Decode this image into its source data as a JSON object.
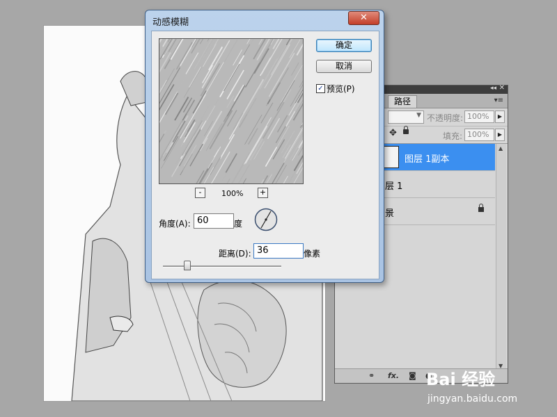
{
  "dialog": {
    "title": "动感模糊",
    "close_symbol": "✕",
    "ok_label": "确定",
    "cancel_label": "取消",
    "preview_label": "预览(P)",
    "preview_checked": true,
    "zoom_minus": "-",
    "zoom_level": "100%",
    "zoom_plus": "+",
    "angle_label": "角度(A):",
    "angle_value": "60",
    "angle_unit": "度",
    "distance_label": "距离(D):",
    "distance_value": "36",
    "distance_unit": "像素",
    "slider_fraction": 0.2
  },
  "layers_panel": {
    "tab_label": "路径",
    "opacity_label": "不透明度:",
    "opacity_value": "100%",
    "fill_label": "填充:",
    "fill_value": "100%",
    "layers": [
      {
        "name": "图层 1副本",
        "selected": true
      },
      {
        "name": "层 1",
        "selected": false
      },
      {
        "name": "景",
        "selected": false
      }
    ],
    "footer_fx": "fx."
  },
  "watermark": {
    "logo": "Bai 经验",
    "url": "jingyan.baidu.com"
  },
  "colors": {
    "selection": "#3b8ff0",
    "dialog_frame": "#a9c3e3",
    "close_button": "#c4402a"
  },
  "icons": [
    "close-icon",
    "checkbox-icon",
    "angle-dial-icon",
    "move-icon",
    "lock-icon",
    "link-icon",
    "fx-icon",
    "mask-icon",
    "chevron-down-icon",
    "panel-menu-icon"
  ]
}
